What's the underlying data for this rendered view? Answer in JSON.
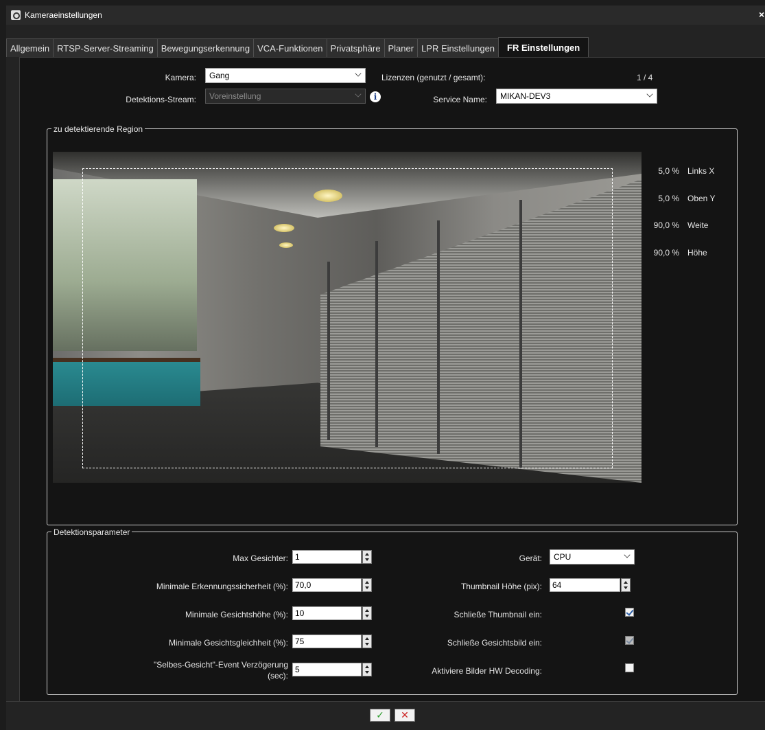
{
  "window": {
    "title": "Kameraeinstellungen",
    "close_glyph": "×"
  },
  "tabs": [
    {
      "label": "Allgemein",
      "active": false
    },
    {
      "label": "RTSP-Server-Streaming",
      "active": false
    },
    {
      "label": "Bewegungserkennung",
      "active": false
    },
    {
      "label": "VCA-Funktionen",
      "active": false
    },
    {
      "label": "Privatsphäre",
      "active": false
    },
    {
      "label": "Planer",
      "active": false
    },
    {
      "label": "LPR Einstellungen",
      "active": false
    },
    {
      "label": "FR Einstellungen",
      "active": true
    }
  ],
  "top": {
    "camera_label": "Kamera:",
    "camera_value": "Gang",
    "stream_label": "Detektions-Stream:",
    "stream_value": "Voreinstellung",
    "licenses_label": "Lizenzen (genutzt / gesamt):",
    "licenses_value": "1 / 4",
    "service_label": "Service Name:",
    "service_value": "MIKAN-DEV3"
  },
  "region": {
    "title": "zu detektierende Region",
    "left_x_value": "5,0 %",
    "left_x_label": "Links X",
    "top_y_value": "5,0 %",
    "top_y_label": "Oben Y",
    "width_value": "90,0 %",
    "width_label": "Weite",
    "height_value": "90,0 %",
    "height_label": "Höhe"
  },
  "params": {
    "title": "Detektionsparameter",
    "max_faces_label": "Max Gesichter:",
    "max_faces_value": "1",
    "min_conf_label": "Minimale Erkennungssicherheit (%):",
    "min_conf_value": "70,0",
    "min_height_label": "Minimale Gesichtshöhe (%):",
    "min_height_value": "10",
    "min_similarity_label": "Minimale Gesichtsgleichheit (%):",
    "min_similarity_value": "75",
    "same_face_label_1": "\"Selbes-Gesicht\"-Event Verzögerung",
    "same_face_label_2": "(sec):",
    "same_face_value": "5",
    "device_label": "Gerät:",
    "device_value": "CPU",
    "thumb_height_label": "Thumbnail Höhe (pix):",
    "thumb_height_value": "64",
    "include_thumb_label": "Schließe Thumbnail ein:",
    "include_thumb_checked": true,
    "include_face_label": "Schließe Gesichtsbild ein:",
    "include_face_checked": true,
    "hw_decoding_label": "Aktiviere Bilder HW Decoding:",
    "hw_decoding_checked": false
  },
  "footer": {
    "ok_glyph": "✓",
    "cancel_glyph": "✕"
  }
}
